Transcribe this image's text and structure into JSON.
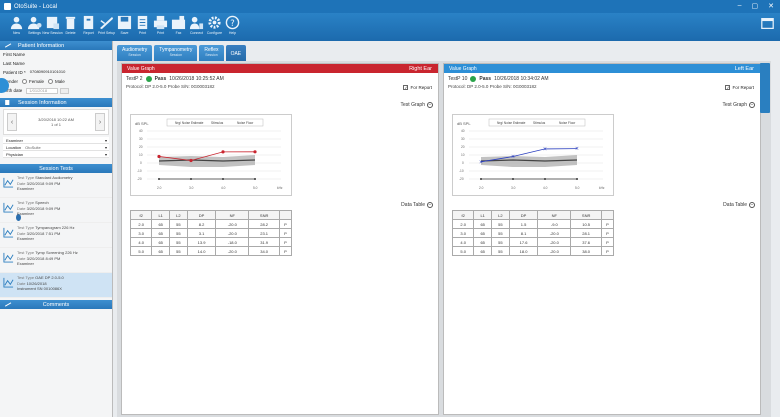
{
  "app_title": "OtoSuite - Local",
  "toolbar": [
    {
      "label": "New",
      "icon": "new-icon"
    },
    {
      "label": "Settings",
      "icon": "settings-icon"
    },
    {
      "label": "New Session",
      "icon": "session-icon"
    },
    {
      "label": "Delete",
      "icon": "delete-icon"
    },
    {
      "label": "Report",
      "icon": "report-icon"
    },
    {
      "label": "Print Setup",
      "icon": "print-setup-icon"
    },
    {
      "label": "Save",
      "icon": "save-icon"
    },
    {
      "label": "Print",
      "icon": "print-icon"
    },
    {
      "label": "Print",
      "icon": "printer-icon"
    },
    {
      "label": "Fax",
      "icon": "fax-icon"
    },
    {
      "label": "Connect",
      "icon": "connect-icon"
    },
    {
      "label": "Configure",
      "icon": "configure-icon"
    },
    {
      "label": "Help",
      "icon": "help-icon"
    }
  ],
  "patient": {
    "header": "Patient Information",
    "first_name_label": "First Name",
    "last_name_label": "Last Name",
    "patient_id_label": "Patient ID *",
    "patient_id_value": "0708090910101010",
    "gender_label": "Gender",
    "female_label": "Female",
    "male_label": "Male",
    "birth_date_label": "Birth date",
    "birth_date_value": "1/01/2018"
  },
  "session": {
    "header": "Session Information",
    "date": "3/20/2018 10:22 AM",
    "count": "1 of 1",
    "examiner_label": "Examiner",
    "location_label": "Location",
    "location_value": "OtoSuite",
    "physician_label": "Physician"
  },
  "session_tests": {
    "header": "Session Tests",
    "items": [
      {
        "type": "Standard Audiometry",
        "date": "3/20/2018 9:09 PM",
        "extra": "Examiner",
        "selected": false
      },
      {
        "type": "Speech",
        "date": "3/20/2018 9:09 PM",
        "extra": "Examiner",
        "selected": false
      },
      {
        "type": "Tympanogram 226 Hz",
        "date": "3/20/2018 7:51 PM",
        "extra": "Examiner",
        "selected": false
      },
      {
        "type": "Tymp Screening 226 Hz",
        "date": "3/20/2018 8:49 PM",
        "extra": "Examiner",
        "selected": false
      },
      {
        "type": "OAE DP 2.0-5.0",
        "date": "10/26/2018",
        "extra": "Instrument SN 0010086X",
        "selected": true
      }
    ]
  },
  "comments": {
    "header": "Comments"
  },
  "tabs": [
    {
      "label": "Audiometry",
      "sub": "Session"
    },
    {
      "label": "Tympanometry",
      "sub": "Session"
    },
    {
      "label": "Reflex",
      "sub": "Session"
    },
    {
      "label": "OAE",
      "sub": ""
    }
  ],
  "right_ear": {
    "name": "Right Ear",
    "value_graph": "Value Graph",
    "test_line": "TestP 2",
    "result": "Pass",
    "datetime": "10/26/2018 10:25:52 AM",
    "protocol": "Protocol: DP 2.0-5.0   Probe S/N: 0G0003182",
    "for_report": "For Report",
    "test_graph_label": "Test Graph",
    "data_table_label": "Data Table",
    "legend": [
      "Nrg/ Noise Estimate",
      "Stimulus",
      "Noise Floor"
    ],
    "table_header": [
      "f2",
      "L1",
      "L2",
      "DP",
      "NF",
      "SNR",
      ""
    ],
    "table_rows": [
      [
        "2.0",
        "65",
        "55",
        "8.2",
        "-20.0",
        "28.2",
        "P"
      ],
      [
        "3.0",
        "65",
        "55",
        "3.1",
        "-20.0",
        "23.1",
        "P"
      ],
      [
        "4.0",
        "65",
        "55",
        "13.9",
        "-18.0",
        "31.9",
        "P"
      ],
      [
        "5.0",
        "65",
        "55",
        "14.0",
        "-20.0",
        "34.0",
        "P"
      ]
    ]
  },
  "left_ear": {
    "name": "Left Ear",
    "value_graph": "Value Graph",
    "test_line": "TestP 10",
    "result": "Pass",
    "datetime": "10/26/2018 10:34:02 AM",
    "protocol": "Protocol: DP 2.0-5.0   Probe S/N: 0G0003182",
    "for_report": "For Report",
    "test_graph_label": "Test Graph",
    "data_table_label": "Data Table",
    "legend": [
      "Nrg/ Noise Estimate",
      "Stimulus",
      "Noise Floor"
    ],
    "table_header": [
      "f2",
      "L1",
      "L2",
      "DP",
      "NF",
      "SNR",
      ""
    ],
    "table_rows": [
      [
        "2.0",
        "65",
        "55",
        "1.5",
        "-9.0",
        "10.5",
        "P"
      ],
      [
        "3.0",
        "65",
        "55",
        "8.1",
        "-20.0",
        "28.1",
        "P"
      ],
      [
        "4.0",
        "65",
        "55",
        "17.6",
        "-20.0",
        "37.6",
        "P"
      ],
      [
        "5.0",
        "65",
        "55",
        "18.0",
        "-20.0",
        "38.0",
        "P"
      ]
    ]
  },
  "colors": {
    "accent": "#2d8fd6",
    "right_ear": "#c9252f",
    "left_ear": "#2d8fd6"
  }
}
